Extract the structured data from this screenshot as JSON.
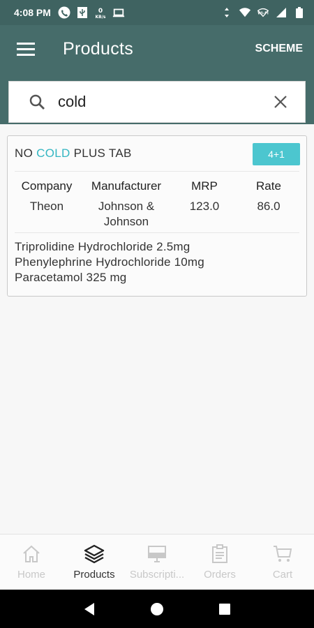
{
  "status_bar": {
    "time": "4:08 PM",
    "icons_left": [
      "phone-icon",
      "usb-icon",
      "data-speed-icon",
      "laptop-icon"
    ],
    "icons_right": [
      "vibrate-icon",
      "wifi-icon",
      "vowifi-icon",
      "signal-icon",
      "battery-icon"
    ]
  },
  "app_bar": {
    "title": "Products",
    "action_label": "SCHEME"
  },
  "search": {
    "value": "cold",
    "placeholder": ""
  },
  "product": {
    "name_prefix": "NO ",
    "name_highlight": "COLD",
    "name_suffix": " PLUS TAB",
    "scheme_badge": "4+1",
    "columns": [
      {
        "header": "Company",
        "value": "Theon"
      },
      {
        "header": "Manufacturer",
        "value": "Johnson & Johnson"
      },
      {
        "header": "MRP",
        "value": "123.0"
      },
      {
        "header": "Rate",
        "value": "86.0"
      }
    ],
    "composition": [
      "Triprolidine Hydrochloride 2.5mg",
      "Phenylephrine Hydrochloride 10mg",
      "Paracetamol 325 mg"
    ]
  },
  "bottom_nav": [
    {
      "label": "Home",
      "icon": "home-icon",
      "active": false
    },
    {
      "label": "Products",
      "icon": "layers-icon",
      "active": true
    },
    {
      "label": "Subscripti...",
      "icon": "monitor-icon",
      "active": false
    },
    {
      "label": "Orders",
      "icon": "clipboard-icon",
      "active": false
    },
    {
      "label": "Cart",
      "icon": "cart-icon",
      "active": false
    }
  ],
  "colors": {
    "status_bar": "#3f6361",
    "app_bar": "#466c6a",
    "highlight": "#34b6c2",
    "badge": "#4cc6cf"
  }
}
